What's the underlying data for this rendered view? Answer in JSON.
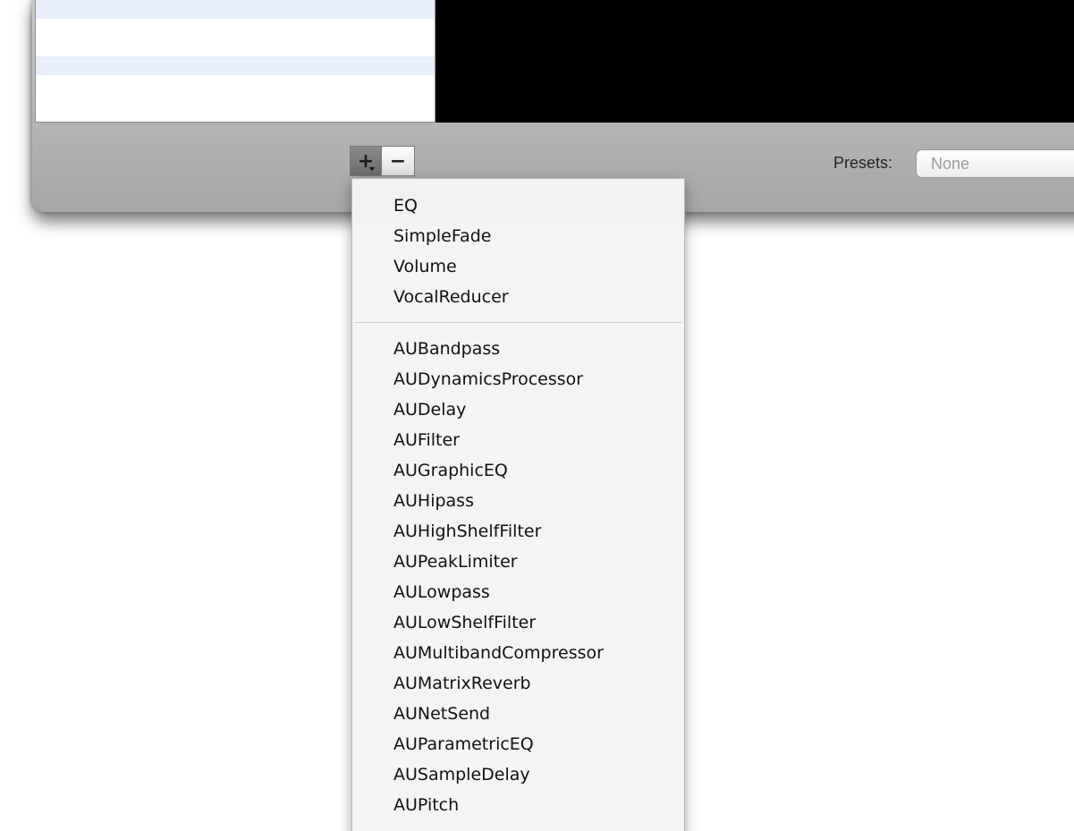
{
  "toolbar": {
    "add_label": "+",
    "remove_label": "−",
    "presets_label": "Presets:",
    "presets_value": "None"
  },
  "menu": {
    "group1": [
      "EQ",
      "SimpleFade",
      "Volume",
      "VocalReducer"
    ],
    "group2": [
      "AUBandpass",
      "AUDynamicsProcessor",
      "AUDelay",
      "AUFilter",
      "AUGraphicEQ",
      "AUHipass",
      "AUHighShelfFilter",
      "AUPeakLimiter",
      "AULowpass",
      "AULowShelfFilter",
      "AUMultibandCompressor",
      "AUMatrixReverb",
      "AUNetSend",
      "AUParametricEQ",
      "AUSampleDelay",
      "AUPitch"
    ]
  }
}
